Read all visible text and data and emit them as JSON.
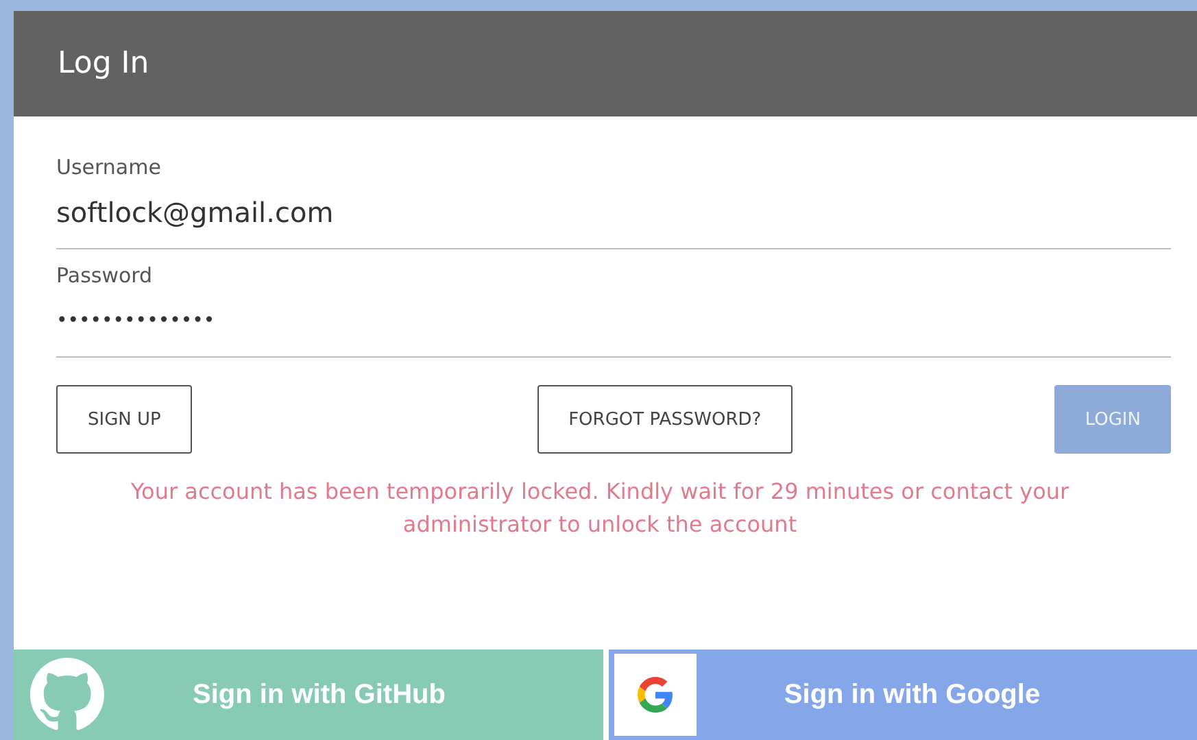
{
  "dialog": {
    "title": "Log In"
  },
  "fields": [
    {
      "label": "Username",
      "value": "softlock@gmail.com"
    },
    {
      "label": "Password",
      "value": "••••••••••••••"
    }
  ],
  "buttons": {
    "sign_up": "SIGN UP",
    "forgot": "FORGOT PASSWORD?",
    "login": {
      "label": "LOGIN",
      "disabled": true
    }
  },
  "error": "Your account has been temporarily locked. Kindly wait for 29 minutes or contact your administrator to unlock the account",
  "social": [
    {
      "kind": "github",
      "label": "Sign in with GitHub"
    },
    {
      "kind": "google",
      "label": "Sign in with Google"
    }
  ]
}
